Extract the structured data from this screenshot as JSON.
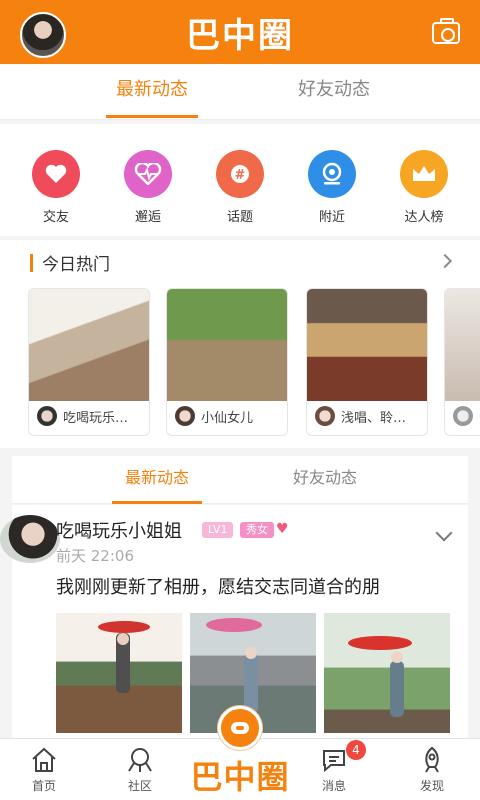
{
  "header": {
    "title": "巴中圈",
    "avatar_icon": "user-avatar",
    "camera_icon": "camera-icon"
  },
  "top_tabs": [
    {
      "label": "最新动态",
      "active": true
    },
    {
      "label": "好友动态",
      "active": false
    }
  ],
  "categories": [
    {
      "label": "交友",
      "icon": "heart-icon",
      "color": "#f04b5a",
      "glyph": "♥"
    },
    {
      "label": "邂逅",
      "icon": "heartbeat-icon",
      "color": "#e063c9",
      "glyph": "♥"
    },
    {
      "label": "话题",
      "icon": "hashtag-icon",
      "color": "#f06a4a",
      "glyph": "#"
    },
    {
      "label": "附近",
      "icon": "location-icon",
      "color": "#2f8fe8",
      "glyph": "●"
    },
    {
      "label": "达人榜",
      "icon": "crown-icon",
      "color": "#f6a623",
      "glyph": "♛"
    }
  ],
  "hot": {
    "title": "今日热门",
    "items": [
      {
        "name": "吃喝玩乐…",
        "img_color": "#c9b8a6"
      },
      {
        "name": "小仙女儿",
        "img_color": "#7d9a58"
      },
      {
        "name": "浅唱、聆…",
        "img_color": "#6c4f3d"
      },
      {
        "name": "",
        "img_color": "#d8cfc8"
      }
    ]
  },
  "feed_tabs": [
    {
      "label": "最新动态",
      "active": true
    },
    {
      "label": "好友动态",
      "active": false
    }
  ],
  "post": {
    "user": "吃喝玩乐小姐姐",
    "level": "LV1",
    "tag": "秀女",
    "time": "前天 22:06",
    "text": "我刚刚更新了相册，愿结交志同道合的朋",
    "images": [
      "#e7e2da",
      "#c9cfcc",
      "#dde6d8"
    ]
  },
  "nav": {
    "items": [
      {
        "label": "首页",
        "icon": "home-icon"
      },
      {
        "label": "社区",
        "icon": "community-icon"
      },
      {
        "label": "消息",
        "icon": "message-icon"
      },
      {
        "label": "发现",
        "icon": "rocket-icon"
      }
    ],
    "center_logo": "巴中圈",
    "message_badge": "4"
  }
}
